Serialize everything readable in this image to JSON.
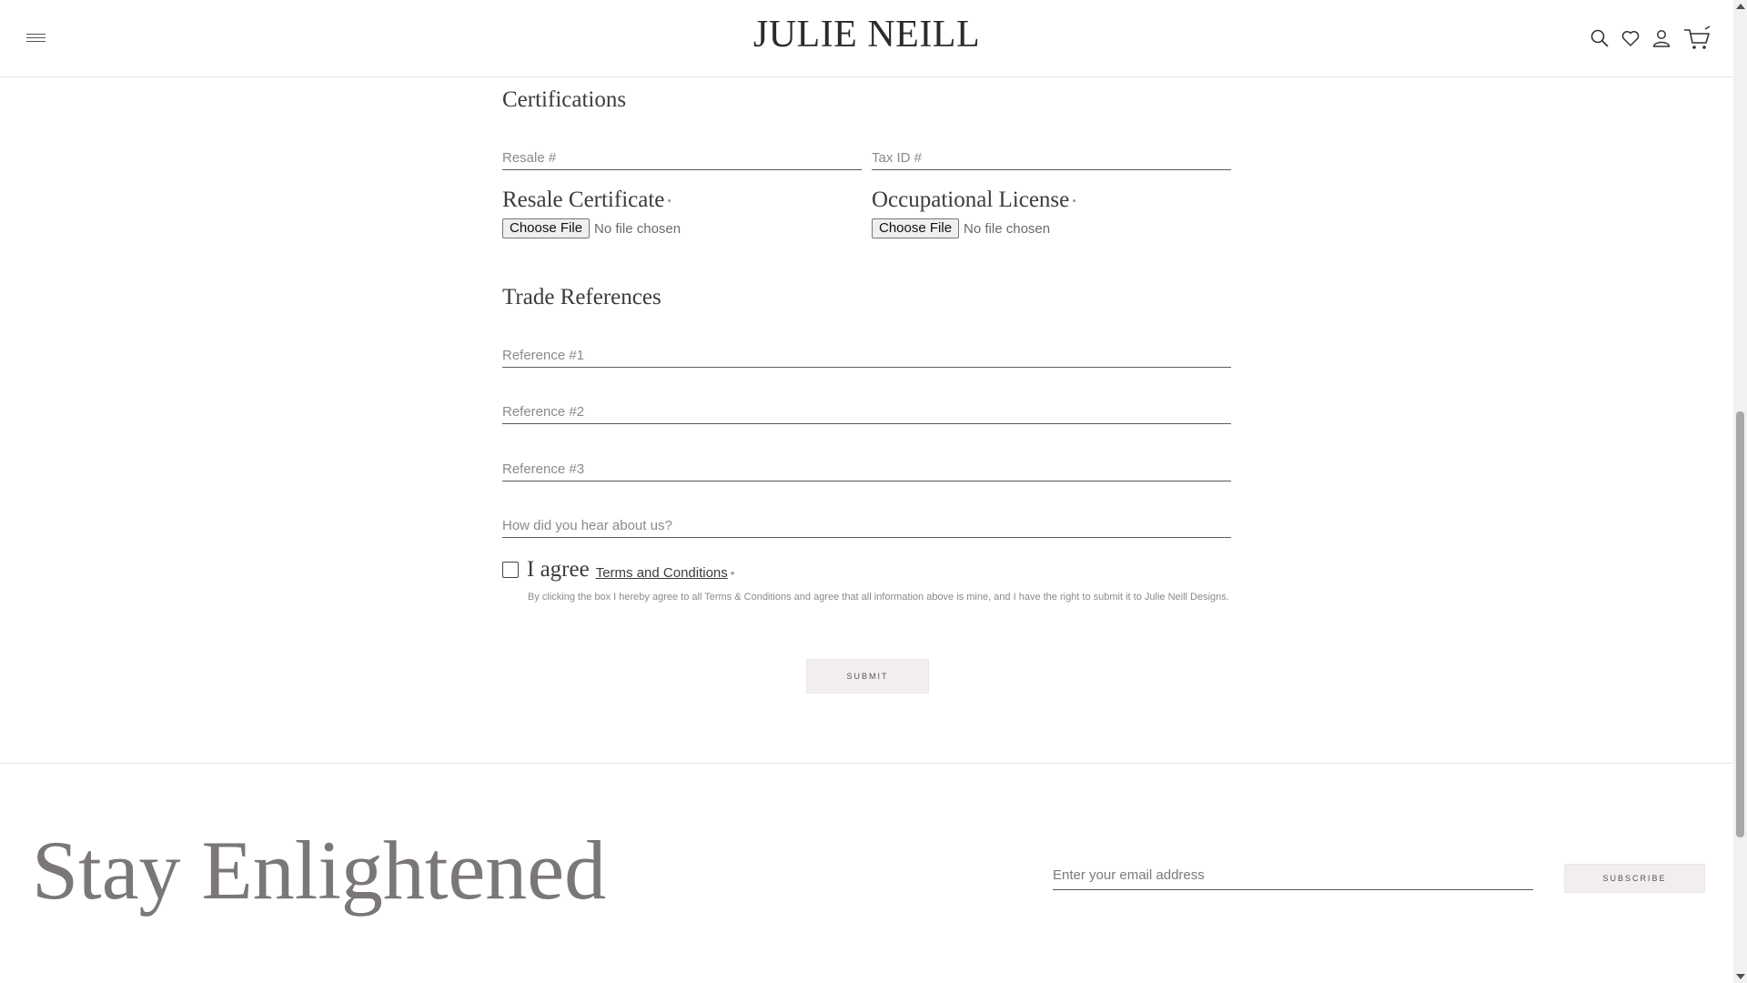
{
  "header": {
    "logo": "JULIE NEILL"
  },
  "certifications": {
    "title": "Certifications",
    "resale_placeholder": "Resale #",
    "tax_placeholder": "Tax ID #",
    "resale_certificate_label": "Resale Certificate",
    "occupational_license_label": "Occupational License",
    "required_marker": "•",
    "file_button_label": "Choose File",
    "file_status": "No file chosen"
  },
  "trade_references": {
    "title": "Trade References",
    "ref1_placeholder": "Reference #1",
    "ref2_placeholder": "Reference #2",
    "ref3_placeholder": "Reference #3",
    "hear_placeholder": "How did you hear about us?"
  },
  "agreement": {
    "agree_text": "I agree",
    "terms_link": "Terms and Conditions",
    "required_marker": "•",
    "disclaimer": "By clicking the box I hereby agree to all Terms & Conditions and agree that all information above is mine, and I have the right to submit it to Julie Neill Designs."
  },
  "submit_label": "SUBMIT",
  "footer": {
    "title": "Stay Enlightened",
    "email_placeholder": "Enter your email address",
    "subscribe_label": "SUBSCRIBE"
  },
  "colors": {
    "accent_button_bg": "#f1eeed",
    "footer_title": "#7b7677"
  }
}
